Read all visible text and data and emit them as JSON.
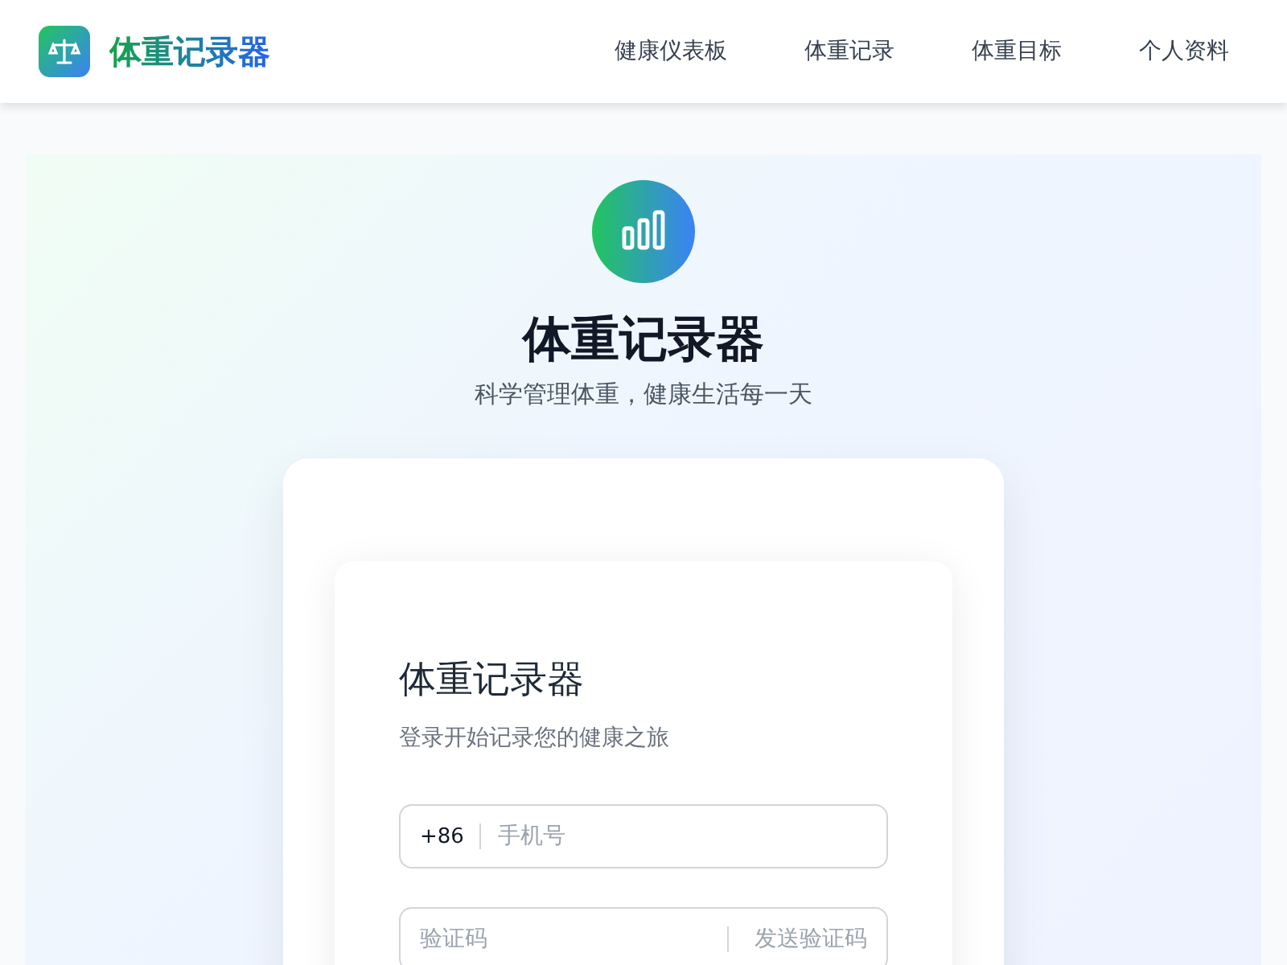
{
  "header": {
    "brand": "体重记录器",
    "nav": [
      {
        "label": "健康仪表板"
      },
      {
        "label": "体重记录"
      },
      {
        "label": "体重目标"
      },
      {
        "label": "个人资料"
      }
    ]
  },
  "hero": {
    "title": "体重记录器",
    "subtitle": "科学管理体重，健康生活每一天"
  },
  "login": {
    "title": "体重记录器",
    "subtitle": "登录开始记录您的健康之旅",
    "phone": {
      "prefix": "+86",
      "placeholder": "手机号"
    },
    "code": {
      "placeholder": "验证码",
      "send_button": "发送验证码"
    }
  }
}
